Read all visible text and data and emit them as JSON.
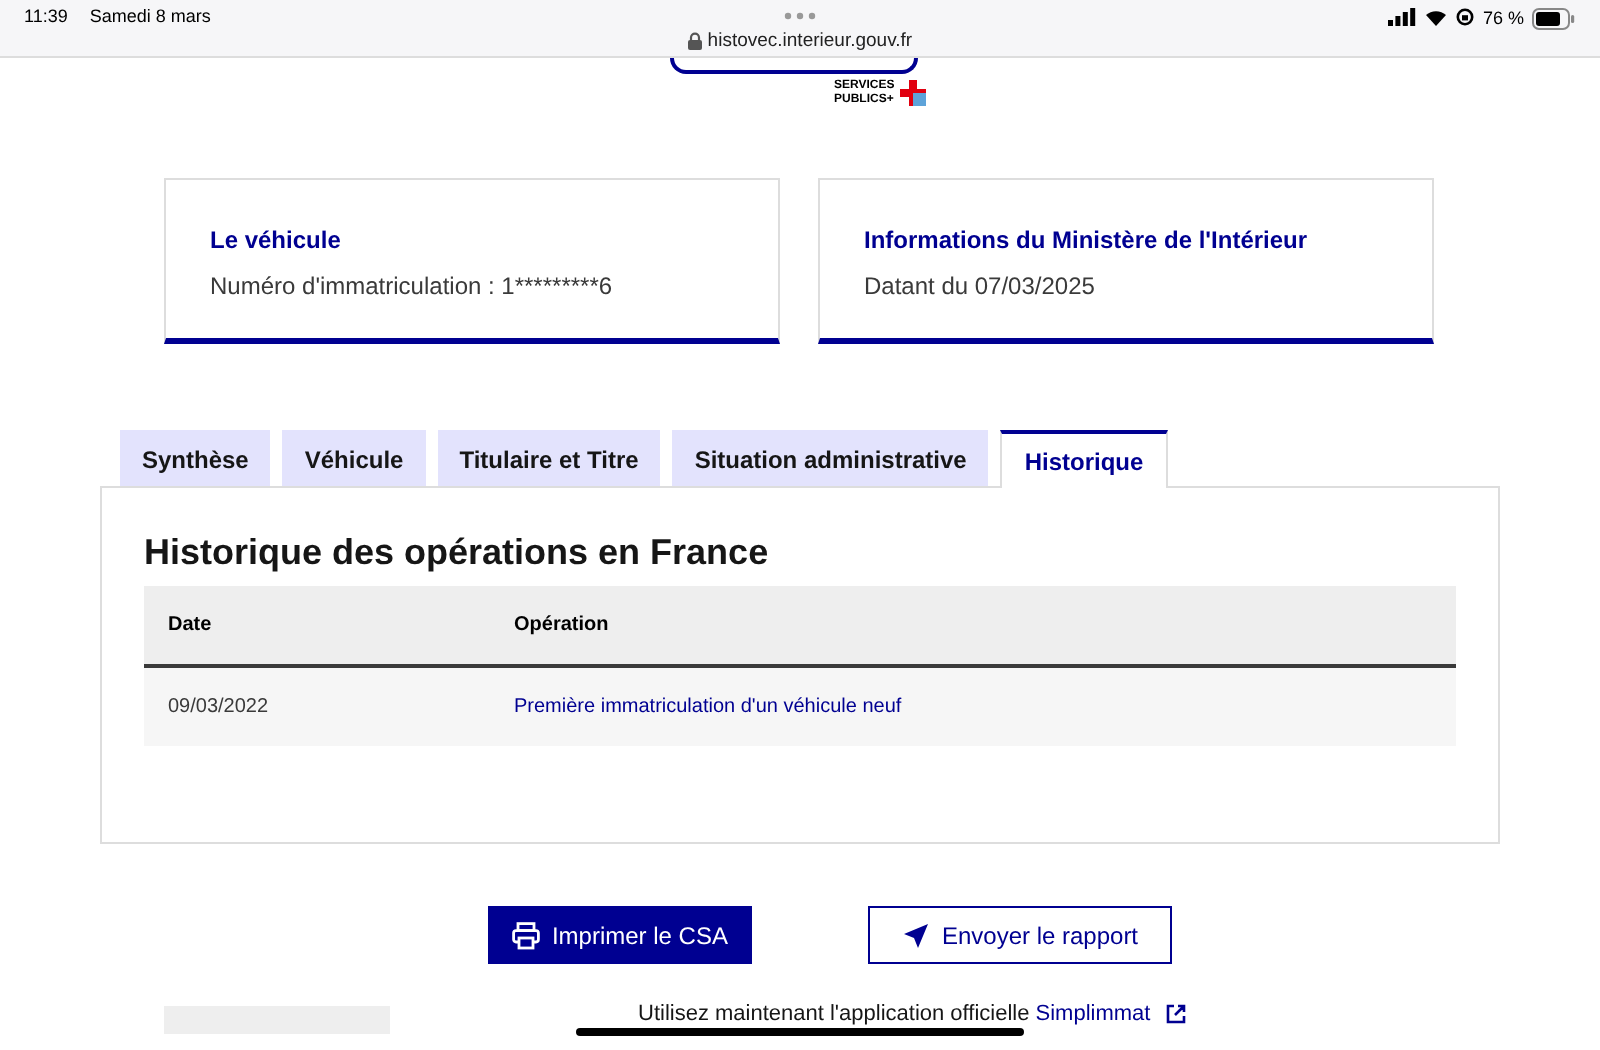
{
  "status_bar": {
    "time": "11:39",
    "date": "Samedi 8 mars",
    "url": "histovec.interieur.gouv.fr",
    "battery": "76 %"
  },
  "header": {
    "logo_lines": [
      "SERVICES",
      "PUBLICS+"
    ]
  },
  "cards": [
    {
      "title": "Le véhicule",
      "text": "Numéro d'immatriculation : 1*********6"
    },
    {
      "title": "Informations du Ministère de l'Intérieur",
      "text": "Datant du 07/03/2025"
    }
  ],
  "tabs": [
    {
      "label": "Synthèse",
      "selected": false
    },
    {
      "label": "Véhicule",
      "selected": false
    },
    {
      "label": "Titulaire et Titre",
      "selected": false
    },
    {
      "label": "Situation administrative",
      "selected": false
    },
    {
      "label": "Historique",
      "selected": true
    }
  ],
  "panel": {
    "title": "Historique des opérations en France",
    "table": {
      "columns": [
        "Date",
        "Opération"
      ],
      "rows": [
        [
          "09/03/2022",
          "Première immatriculation d'un véhicule neuf"
        ]
      ]
    }
  },
  "buttons": [
    {
      "label": "Imprimer le CSA",
      "kind": "primary"
    },
    {
      "label": "Envoyer le rapport",
      "kind": "secondary"
    }
  ],
  "footer": {
    "text": "Utilisez maintenant l'application officielle",
    "link": "Simplimmat"
  }
}
